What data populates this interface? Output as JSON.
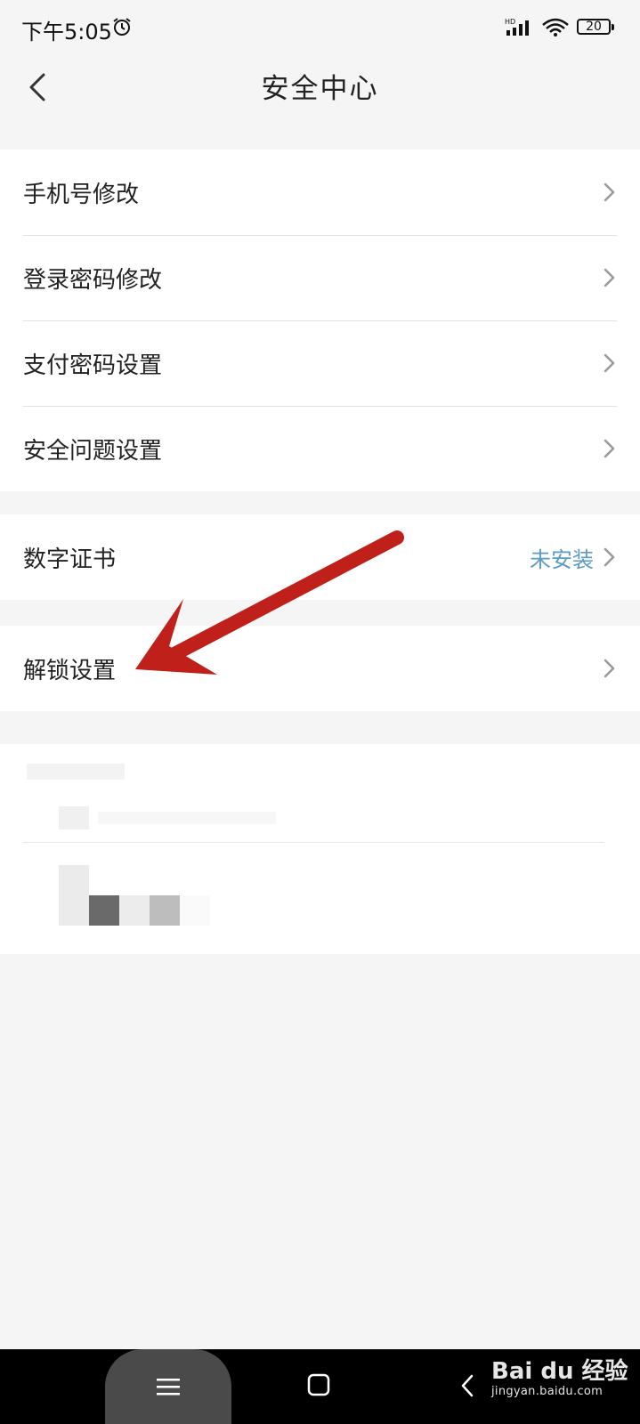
{
  "status_bar": {
    "time": "下午5:05",
    "signal_label": "HD",
    "battery": "20",
    "icons": [
      "alarm-icon",
      "signal-icon",
      "wifi-icon",
      "battery-icon"
    ]
  },
  "header": {
    "title": "安全中心",
    "back_icon": "chevron-left-icon"
  },
  "groups": [
    {
      "items": [
        {
          "label": "手机号修改"
        },
        {
          "label": "登录密码修改"
        },
        {
          "label": "支付密码设置"
        },
        {
          "label": "安全问题设置"
        }
      ]
    },
    {
      "items": [
        {
          "label": "数字证书",
          "value": "未安装"
        }
      ]
    },
    {
      "items": [
        {
          "label": "解锁设置"
        }
      ]
    }
  ],
  "annotation_arrow": {
    "color": "#c0201a",
    "target": "解锁设置"
  },
  "system_nav": {
    "icons": [
      "menu-icon",
      "home-icon",
      "back-icon"
    ]
  },
  "watermark": {
    "title": "Bai du 经验",
    "url": "jingyan.baidu.com"
  },
  "colors": {
    "background": "#f5f5f5",
    "card": "#ffffff",
    "accent_value": "#5b9cc6",
    "divider": "#e2e2e2"
  }
}
